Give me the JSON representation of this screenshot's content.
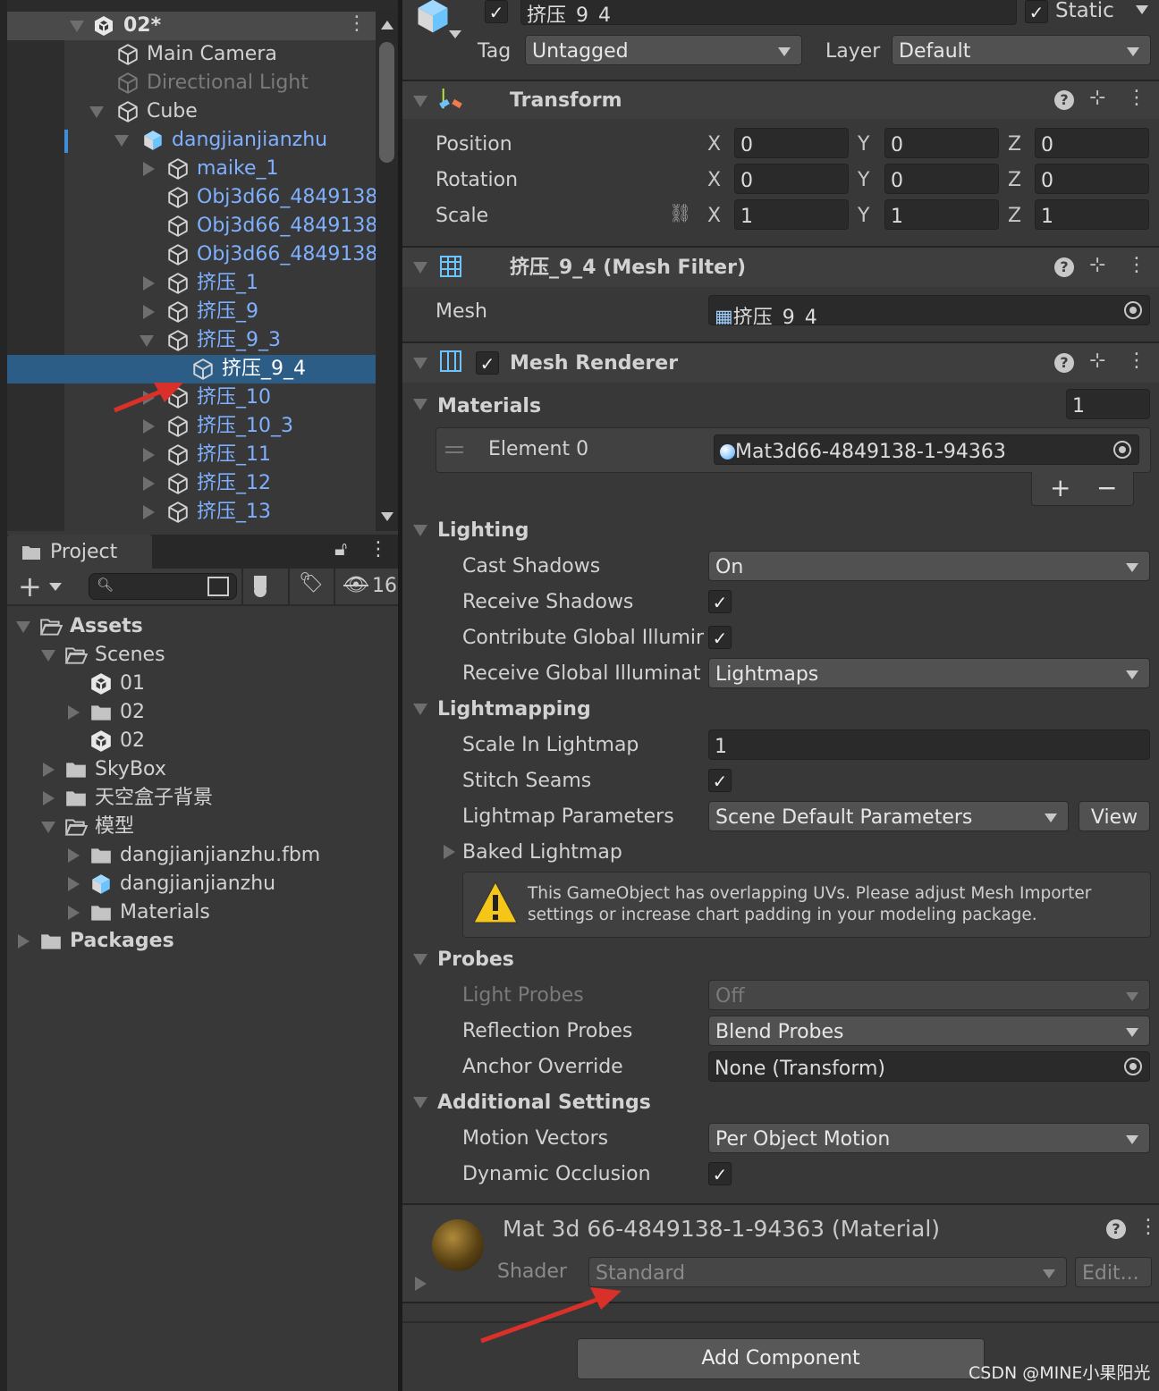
{
  "hierarchy": {
    "scene": "02*",
    "items": [
      {
        "label": "Main Camera",
        "depth": 0,
        "arrow": "none",
        "color": "normal",
        "icon": "gameobject"
      },
      {
        "label": "Directional Light",
        "depth": 0,
        "arrow": "none",
        "color": "dim",
        "icon": "gameobject"
      },
      {
        "label": "Cube",
        "depth": 0,
        "arrow": "down",
        "color": "normal",
        "icon": "gameobject"
      },
      {
        "label": "dangjianjianzhu",
        "depth": 1,
        "arrow": "down",
        "color": "blue",
        "icon": "prefab"
      },
      {
        "label": "maike_1",
        "depth": 2,
        "arrow": "right",
        "color": "blue",
        "icon": "gameobject"
      },
      {
        "label": "Obj3d66_4849138",
        "depth": 2,
        "arrow": "none",
        "color": "blue",
        "icon": "gameobject"
      },
      {
        "label": "Obj3d66_4849138",
        "depth": 2,
        "arrow": "none",
        "color": "blue",
        "icon": "gameobject"
      },
      {
        "label": "Obj3d66_4849138",
        "depth": 2,
        "arrow": "none",
        "color": "blue",
        "icon": "gameobject"
      },
      {
        "label": "挤压_1",
        "depth": 2,
        "arrow": "right",
        "color": "blue",
        "icon": "gameobject"
      },
      {
        "label": "挤压_9",
        "depth": 2,
        "arrow": "right",
        "color": "blue",
        "icon": "gameobject"
      },
      {
        "label": "挤压_9_3",
        "depth": 2,
        "arrow": "down",
        "color": "blue",
        "icon": "gameobject"
      },
      {
        "label": "挤压_9_4",
        "depth": 3,
        "arrow": "none",
        "color": "blue",
        "icon": "gameobject",
        "selected": true
      },
      {
        "label": "挤压_10",
        "depth": 2,
        "arrow": "right",
        "color": "blue",
        "icon": "gameobject"
      },
      {
        "label": "挤压_10_3",
        "depth": 2,
        "arrow": "right",
        "color": "blue",
        "icon": "gameobject"
      },
      {
        "label": "挤压_11",
        "depth": 2,
        "arrow": "right",
        "color": "blue",
        "icon": "gameobject"
      },
      {
        "label": "挤压_12",
        "depth": 2,
        "arrow": "right",
        "color": "blue",
        "icon": "gameobject"
      },
      {
        "label": "挤压_13",
        "depth": 2,
        "arrow": "right",
        "color": "blue",
        "icon": "gameobject"
      }
    ]
  },
  "project": {
    "tab": "Project",
    "hidden_count": "16",
    "items": [
      {
        "label": "Assets",
        "depth": 0,
        "arrow": "down",
        "icon": "folder-open",
        "bold": true
      },
      {
        "label": "Scenes",
        "depth": 1,
        "arrow": "down",
        "icon": "folder-open"
      },
      {
        "label": "01",
        "depth": 2,
        "arrow": "none",
        "icon": "unity-scene"
      },
      {
        "label": "02",
        "depth": 2,
        "arrow": "right",
        "icon": "folder"
      },
      {
        "label": "02",
        "depth": 2,
        "arrow": "none",
        "icon": "unity-scene"
      },
      {
        "label": "SkyBox",
        "depth": 1,
        "arrow": "right",
        "icon": "folder"
      },
      {
        "label": "天空盒子背景",
        "depth": 1,
        "arrow": "right",
        "icon": "folder"
      },
      {
        "label": "模型",
        "depth": 1,
        "arrow": "down",
        "icon": "folder-open"
      },
      {
        "label": "dangjianjianzhu.fbm",
        "depth": 2,
        "arrow": "right",
        "icon": "folder"
      },
      {
        "label": "dangjianjianzhu",
        "depth": 2,
        "arrow": "right",
        "icon": "prefab"
      },
      {
        "label": "Materials",
        "depth": 2,
        "arrow": "right",
        "icon": "folder"
      },
      {
        "label": "Packages",
        "depth": 0,
        "arrow": "right",
        "icon": "folder",
        "bold": true
      }
    ]
  },
  "inspector": {
    "object_name": "挤压_9_4",
    "active": true,
    "static_label": "Static",
    "static": true,
    "tag_label": "Tag",
    "tag": "Untagged",
    "layer_label": "Layer",
    "layer": "Default",
    "transform": {
      "title": "Transform",
      "rows": [
        {
          "label": "Position",
          "x": "0",
          "y": "0",
          "z": "0"
        },
        {
          "label": "Rotation",
          "x": "0",
          "y": "0",
          "z": "0"
        },
        {
          "label": "Scale",
          "x": "1",
          "y": "1",
          "z": "1"
        }
      ],
      "axis": {
        "x": "X",
        "y": "Y",
        "z": "Z"
      }
    },
    "mesh_filter": {
      "title": "挤压_9_4 (Mesh Filter)",
      "mesh_label": "Mesh",
      "mesh": "挤压_9_4"
    },
    "mesh_renderer": {
      "title": "Mesh Renderer",
      "enabled": true,
      "materials_label": "Materials",
      "materials_count": "1",
      "element_label": "Element 0",
      "element_value": "Mat3d66-4849138-1-94363",
      "add": "+",
      "remove": "−",
      "lighting": "Lighting",
      "cast_shadows_label": "Cast Shadows",
      "cast_shadows": "On",
      "receive_shadows_label": "Receive Shadows",
      "contribute_gi_label": "Contribute Global Illumir",
      "receive_gi_label": "Receive Global Illuminat",
      "receive_gi": "Lightmaps",
      "lightmapping": "Lightmapping",
      "scale_lightmap_label": "Scale In Lightmap",
      "scale_lightmap": "1",
      "stitch_seams_label": "Stitch Seams",
      "lightmap_params_label": "Lightmap Parameters",
      "lightmap_params": "Scene Default Parameters",
      "view": "View",
      "baked_lightmap": "Baked Lightmap",
      "warning": "This GameObject has overlapping UVs. Please adjust Mesh Importer settings or increase chart padding in your modeling package.",
      "probes": "Probes",
      "light_probes_label": "Light Probes",
      "light_probes": "Off",
      "reflection_probes_label": "Reflection Probes",
      "reflection_probes": "Blend Probes",
      "anchor_label": "Anchor Override",
      "anchor": "None (Transform)",
      "additional": "Additional Settings",
      "motion_vectors_label": "Motion Vectors",
      "motion_vectors": "Per Object Motion",
      "dynamic_occlusion_label": "Dynamic Occlusion"
    },
    "material": {
      "title": "Mat 3d 66-4849138-1-94363 (Material)",
      "shader_label": "Shader",
      "shader": "Standard",
      "edit": "Edit..."
    },
    "add_component": "Add Component"
  },
  "watermark": "CSDN @MINE小果阳光",
  "colors": {
    "selection": "#2c5d87",
    "prefab_text": "#7fb0ff",
    "annotation_arrow": "#d9302a"
  }
}
